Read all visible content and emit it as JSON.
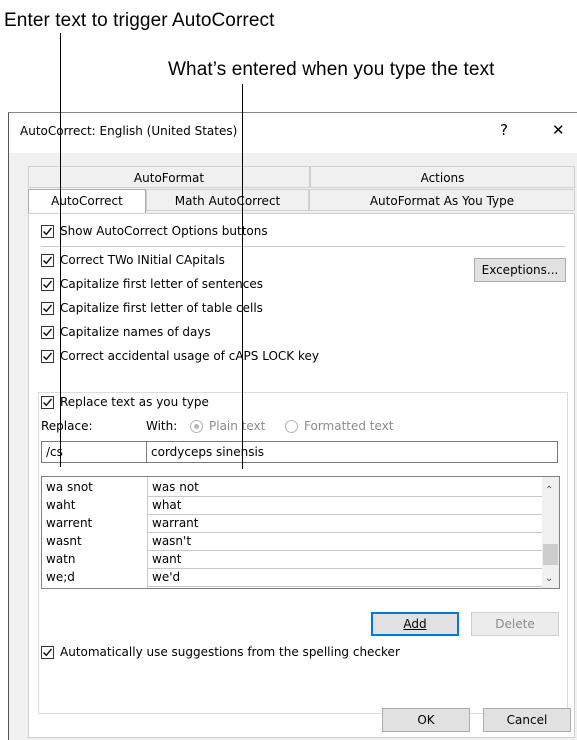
{
  "callouts": {
    "trigger": "Enter text to trigger AutoCorrect",
    "entered": "What’s entered when you type the text"
  },
  "dialog": {
    "title": "AutoCorrect: English (United States)",
    "help": "?",
    "close": "✕"
  },
  "tabs": {
    "row1": [
      "AutoFormat",
      "Actions"
    ],
    "row2": [
      "AutoCorrect",
      "Math AutoCorrect",
      "AutoFormat As You Type"
    ]
  },
  "options": {
    "show_buttons": "Show AutoCorrect Options buttons",
    "two_initial": "Correct TWo INitial CApitals",
    "first_sentence": "Capitalize first letter of sentences",
    "first_table": "Capitalize first letter of table cells",
    "days": "Capitalize names of days",
    "caps_lock": "Correct accidental usage of cAPS LOCK key",
    "exceptions": "Exceptions..."
  },
  "replace": {
    "checkbox": "Replace text as you type",
    "replace_label": "Replace:",
    "with_label": "With:",
    "plain": "Plain text",
    "formatted": "Formatted text",
    "replace_value": "/cs",
    "with_value": "cordyceps sinensis"
  },
  "entries": [
    {
      "from": "wa snot",
      "to": "was not"
    },
    {
      "from": "waht",
      "to": "what"
    },
    {
      "from": "warrent",
      "to": "warrant"
    },
    {
      "from": "wasnt",
      "to": "wasn't"
    },
    {
      "from": "watn",
      "to": "want"
    },
    {
      "from": "we;d",
      "to": "we'd"
    }
  ],
  "buttons": {
    "add": "Add",
    "delete": "Delete",
    "ok": "OK",
    "cancel": "Cancel"
  },
  "spelling": "Automatically use suggestions from the spelling checker"
}
